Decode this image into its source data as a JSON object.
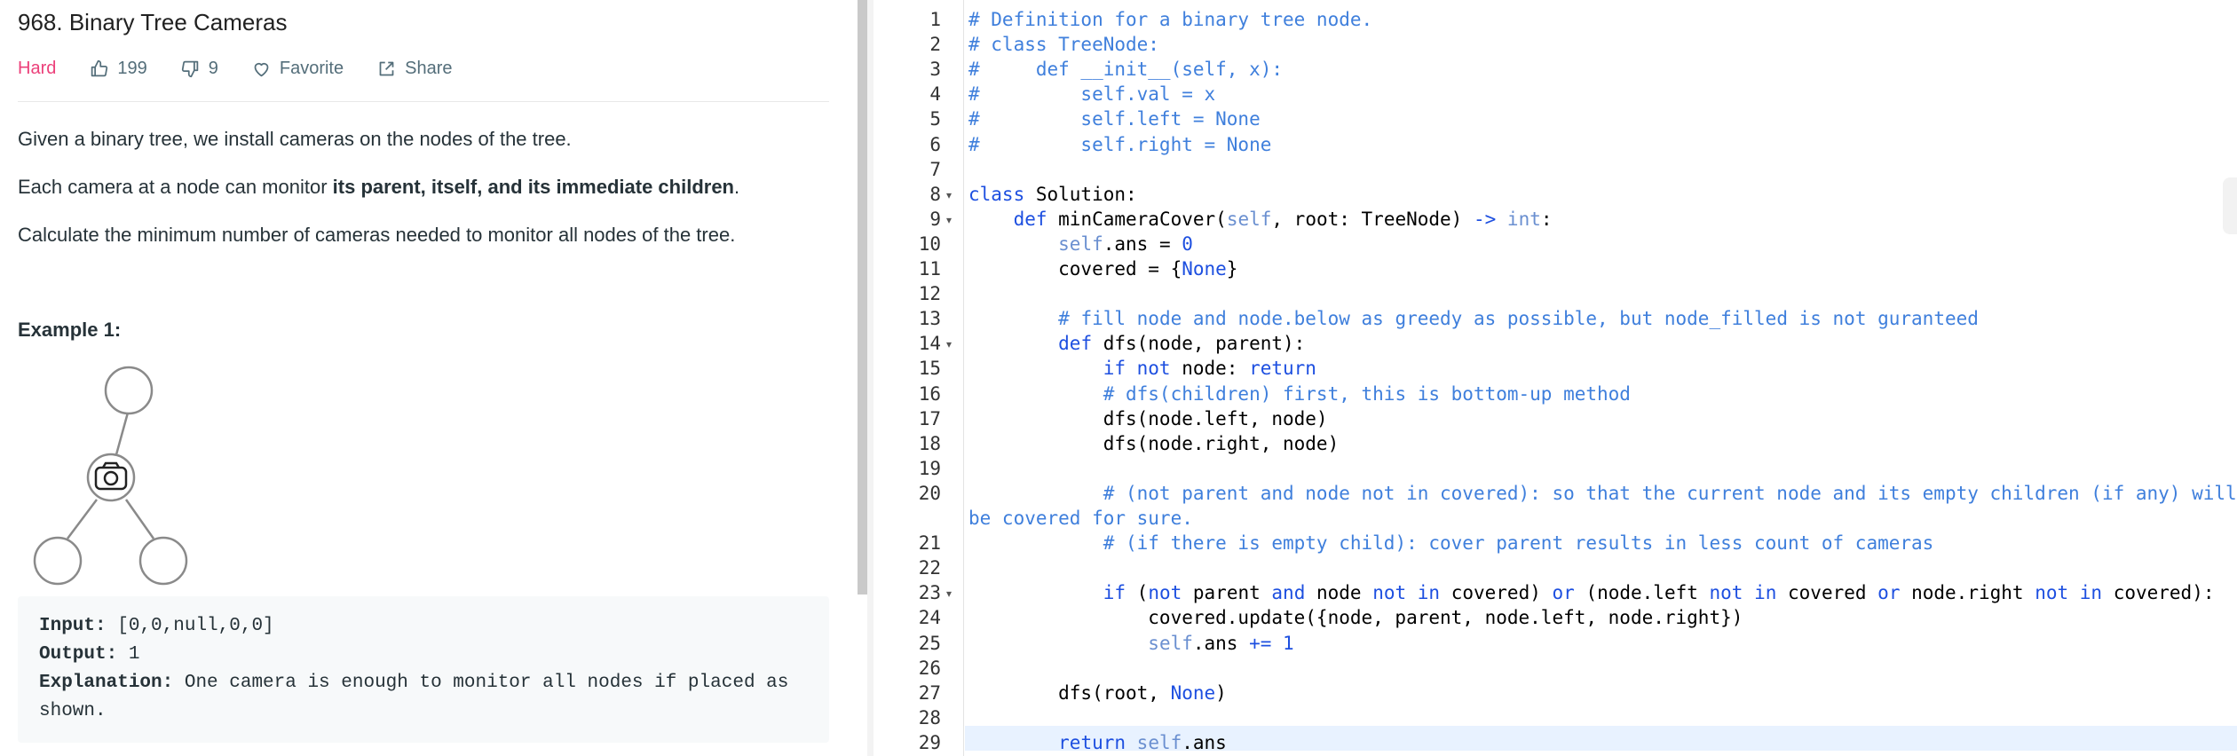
{
  "problem": {
    "title": "968. Binary Tree Cameras",
    "difficulty": "Hard",
    "likes": "199",
    "dislikes": "9",
    "favorite_label": "Favorite",
    "share_label": "Share",
    "desc1": "Given a binary tree, we install cameras on the nodes of the tree.",
    "desc2_pre": "Each camera at a node can monitor ",
    "desc2_bold": "its parent, itself, and its immediate children",
    "desc2_post": ".",
    "desc3": "Calculate the minimum number of cameras needed to monitor all nodes of the tree.",
    "example_heading": "Example 1:",
    "input_label": "Input:",
    "input_value": " [0,0,null,0,0]",
    "output_label": "Output:",
    "output_value": " 1",
    "explanation_label": "Explanation:",
    "explanation_line1": " One camera is enough to monitor all nodes if placed as",
    "explanation_line2": "shown."
  },
  "colors": {
    "accent_hard": "#ec407a",
    "comment": "#3f7fdc",
    "keyword": "#1d4fe0",
    "active_line": "#e8f2ff"
  },
  "icons": [
    "thumbs-up-icon",
    "thumbs-down-icon",
    "heart-icon",
    "share-icon",
    "camera-icon"
  ],
  "editor": {
    "line_numbers": [
      "1",
      "2",
      "3",
      "4",
      "5",
      "6",
      "7",
      "8",
      "9",
      "10",
      "11",
      "12",
      "13",
      "14",
      "15",
      "16",
      "17",
      "18",
      "19",
      "20",
      "21",
      "22",
      "23",
      "24",
      "25",
      "26",
      "27",
      "28",
      "29"
    ],
    "folded_lines": [
      "8",
      "9",
      "14",
      "23"
    ],
    "lines": [
      [
        [
          "c",
          "# Definition for a binary tree node."
        ]
      ],
      [
        [
          "c",
          "# class TreeNode:"
        ]
      ],
      [
        [
          "c",
          "#     def __init__(self, x):"
        ]
      ],
      [
        [
          "c",
          "#         self.val = x"
        ]
      ],
      [
        [
          "c",
          "#         self.left = None"
        ]
      ],
      [
        [
          "c",
          "#         self.right = None"
        ]
      ],
      [],
      [
        [
          "k",
          "class"
        ],
        [
          "n",
          " Solution:"
        ]
      ],
      [
        [
          "n",
          "    "
        ],
        [
          "k",
          "def"
        ],
        [
          "n",
          " minCameraCover("
        ],
        [
          "s",
          "self"
        ],
        [
          "n",
          ", root: TreeNode) "
        ],
        [
          "k",
          "->"
        ],
        [
          "n",
          " "
        ],
        [
          "s",
          "int"
        ],
        [
          "n",
          ":"
        ]
      ],
      [
        [
          "n",
          "        "
        ],
        [
          "s",
          "self"
        ],
        [
          "n",
          ".ans = "
        ],
        [
          "k",
          "0"
        ]
      ],
      [
        [
          "n",
          "        covered = {"
        ],
        [
          "k",
          "None"
        ],
        [
          "n",
          "}"
        ]
      ],
      [],
      [
        [
          "n",
          "        "
        ],
        [
          "c",
          "# fill node and node.below as greedy as possible, but node_filled is not guranteed"
        ]
      ],
      [
        [
          "n",
          "        "
        ],
        [
          "k",
          "def"
        ],
        [
          "n",
          " dfs(node, parent):"
        ]
      ],
      [
        [
          "n",
          "            "
        ],
        [
          "k",
          "if not"
        ],
        [
          "n",
          " node: "
        ],
        [
          "k",
          "return"
        ]
      ],
      [
        [
          "n",
          "            "
        ],
        [
          "c",
          "# dfs(children) first, this is bottom-up method"
        ]
      ],
      [
        [
          "n",
          "            dfs(node.left, node)"
        ]
      ],
      [
        [
          "n",
          "            dfs(node.right, node)"
        ]
      ],
      [],
      [
        [
          "n",
          "            "
        ],
        [
          "c",
          "# (not parent and node not in covered): so that the current node and its empty children (if any) will"
        ]
      ],
      [
        [
          "c",
          "be covered for sure."
        ]
      ],
      [
        [
          "n",
          "            "
        ],
        [
          "c",
          "# (if there is empty child): cover parent results in less count of cameras"
        ]
      ],
      [],
      [
        [
          "n",
          "            "
        ],
        [
          "k",
          "if"
        ],
        [
          "n",
          " ("
        ],
        [
          "k",
          "not"
        ],
        [
          "n",
          " parent "
        ],
        [
          "k",
          "and"
        ],
        [
          "n",
          " node "
        ],
        [
          "k",
          "not in"
        ],
        [
          "n",
          " covered) "
        ],
        [
          "k",
          "or"
        ],
        [
          "n",
          " (node.left "
        ],
        [
          "k",
          "not in"
        ],
        [
          "n",
          " covered "
        ],
        [
          "k",
          "or"
        ],
        [
          "n",
          " node.right "
        ],
        [
          "k",
          "not in"
        ],
        [
          "n",
          " covered):"
        ]
      ],
      [
        [
          "n",
          "                covered.update({node, parent, node.left, node.right})"
        ]
      ],
      [
        [
          "n",
          "                "
        ],
        [
          "s",
          "self"
        ],
        [
          "n",
          ".ans "
        ],
        [
          "k",
          "+="
        ],
        [
          "n",
          " "
        ],
        [
          "k",
          "1"
        ]
      ],
      [],
      [
        [
          "n",
          "        dfs(root, "
        ],
        [
          "k",
          "None"
        ],
        [
          "n",
          ")"
        ]
      ],
      [],
      [
        [
          "n",
          "        "
        ],
        [
          "k",
          "return"
        ],
        [
          "n",
          " "
        ],
        [
          "s",
          "self"
        ],
        [
          "n",
          ".ans"
        ]
      ]
    ]
  }
}
